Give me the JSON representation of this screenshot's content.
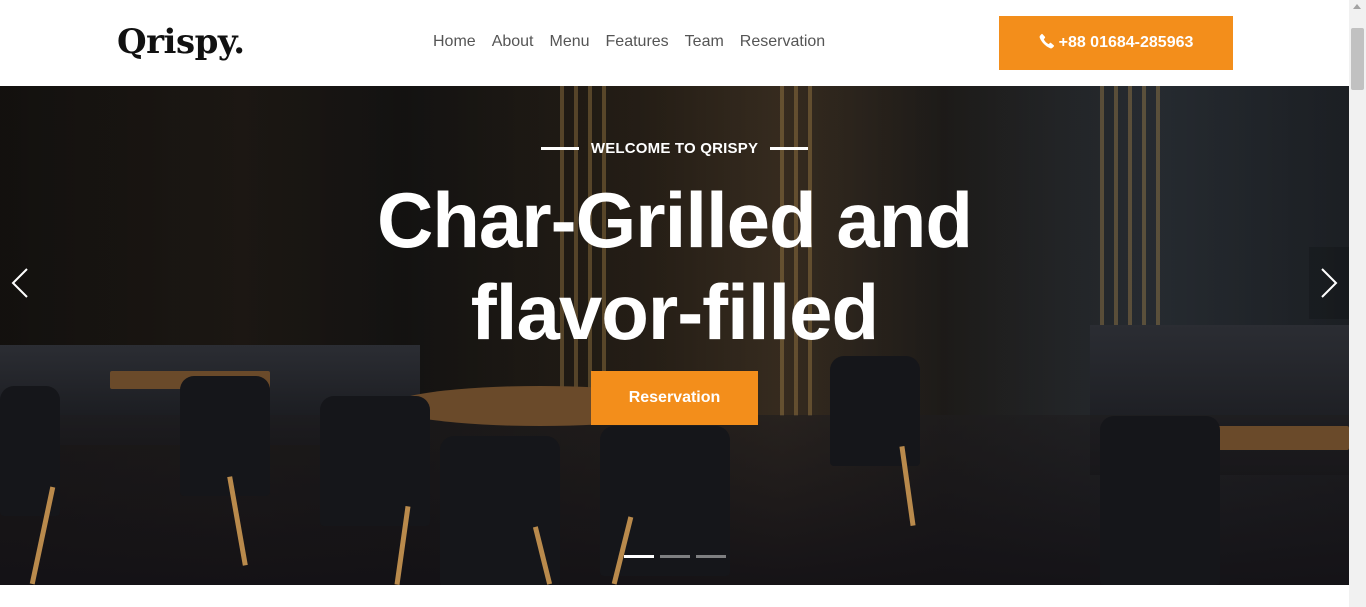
{
  "brand": {
    "logo": "Qrispy."
  },
  "nav": {
    "items": [
      {
        "label": "Home"
      },
      {
        "label": "About"
      },
      {
        "label": "Menu"
      },
      {
        "label": "Features"
      },
      {
        "label": "Team"
      },
      {
        "label": "Reservation"
      }
    ],
    "phone": {
      "icon": "phone-icon",
      "label": "+88 01684-285963"
    }
  },
  "hero": {
    "eyebrow": "WELCOME TO QRISPY",
    "title_line1": "Char-Grilled and",
    "title_line2": "flavor-filled",
    "cta_label": "Reservation",
    "slides_total": 3,
    "active_slide": 1
  },
  "colors": {
    "accent": "#f38e1b",
    "nav_text": "#555555",
    "logo_text": "#111111",
    "hero_text": "#ffffff"
  }
}
